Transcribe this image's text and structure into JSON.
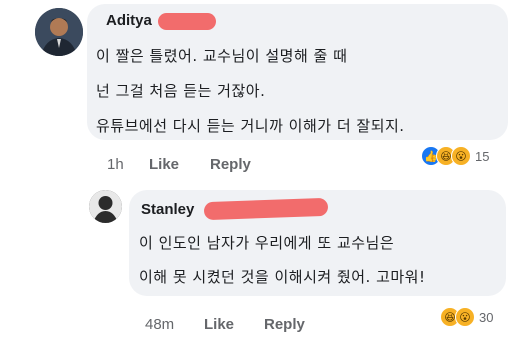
{
  "comment": {
    "author": "Aditya",
    "lines": [
      "이 짤은 틀렸어. 교수님이 설명해 줄 때",
      "넌 그걸 처음 듣는 거잖아.",
      "유튜브에선 다시 듣는 거니까 이해가 더 잘되지."
    ],
    "time": "1h",
    "like_label": "Like",
    "reply_label": "Reply",
    "reaction_count": "15"
  },
  "reply": {
    "author": "Stanley",
    "lines": [
      "이 인도인 남자가 우리에게 또 교수님은",
      "이해 못 시켰던 것을 이해시켜 줬어. 고마워!"
    ],
    "time": "48m",
    "like_label": "Like",
    "reply_label": "Reply",
    "reaction_count": "30"
  },
  "colors": {
    "bubble": "#f0f2f5",
    "redaction": "#f26c6c",
    "meta": "#65676b"
  }
}
